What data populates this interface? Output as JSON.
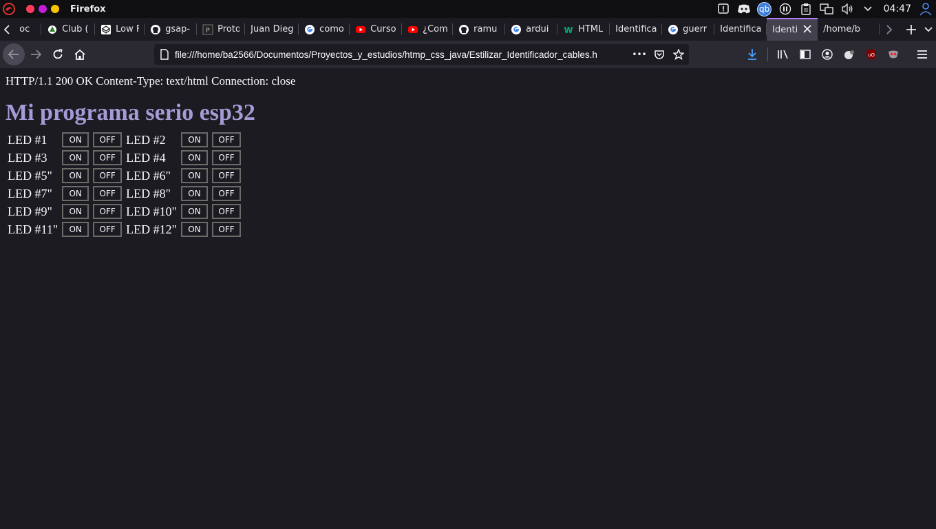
{
  "system_bar": {
    "app_name": "Firefox",
    "clock": "04:47",
    "window_dot_colors": [
      "#ff3b5c",
      "#c21ed7",
      "#f5c300"
    ],
    "tray_icons": [
      "notification-icon",
      "discord-icon",
      "qbittorrent-icon",
      "tray-app-icon",
      "clipboard-icon",
      "network-icon",
      "volume-icon",
      "chevron-down-icon",
      "user-icon"
    ],
    "qb_label": "qb"
  },
  "tabs": [
    {
      "label": "oc",
      "icon": "generic-favicon",
      "active": false
    },
    {
      "label": "Club (",
      "icon": "club-favicon",
      "active": false
    },
    {
      "label": "Low F",
      "icon": "codepen-favicon",
      "active": false
    },
    {
      "label": "gsap-",
      "icon": "github-favicon",
      "active": false
    },
    {
      "label": "Proto",
      "icon": "proto-favicon",
      "active": false
    },
    {
      "label": "Juan Dieg",
      "icon": "",
      "active": false
    },
    {
      "label": "como",
      "icon": "google-favicon",
      "active": false
    },
    {
      "label": "Curso",
      "icon": "youtube-favicon",
      "active": false
    },
    {
      "label": "¿Com",
      "icon": "youtube-favicon",
      "active": false
    },
    {
      "label": "ramu",
      "icon": "github-favicon",
      "active": false
    },
    {
      "label": "ardui",
      "icon": "google-favicon",
      "active": false
    },
    {
      "label": "HTML",
      "icon": "w3schools-favicon",
      "active": false
    },
    {
      "label": "Identifica",
      "icon": "",
      "active": false
    },
    {
      "label": "guerr",
      "icon": "google-favicon",
      "active": false
    },
    {
      "label": "Identifica",
      "icon": "",
      "active": false
    },
    {
      "label": "Identi",
      "icon": "",
      "active": true
    },
    {
      "label": "/home/b",
      "icon": "",
      "active": false
    }
  ],
  "toolbar": {
    "url": "file:///home/ba2566/Documentos/Proyectos_y_estudios/htmp_css_java/Estilizar_Identificador_cables.h",
    "more_label": "•••"
  },
  "page": {
    "http_line": "HTTP/1.1 200 OK Content-Type: text/html Connection: close",
    "title": "Mi programa serio esp32",
    "on_label": "ON",
    "off_label": "OFF",
    "leds": [
      [
        "LED #1",
        "LED #2"
      ],
      [
        "LED #3",
        "LED #4"
      ],
      [
        "LED #5\"",
        "LED #6\""
      ],
      [
        "LED #7\"",
        "LED #8\""
      ],
      [
        "LED #9\"",
        "LED #10\""
      ],
      [
        "LED #11\"",
        "LED #12\""
      ]
    ]
  }
}
